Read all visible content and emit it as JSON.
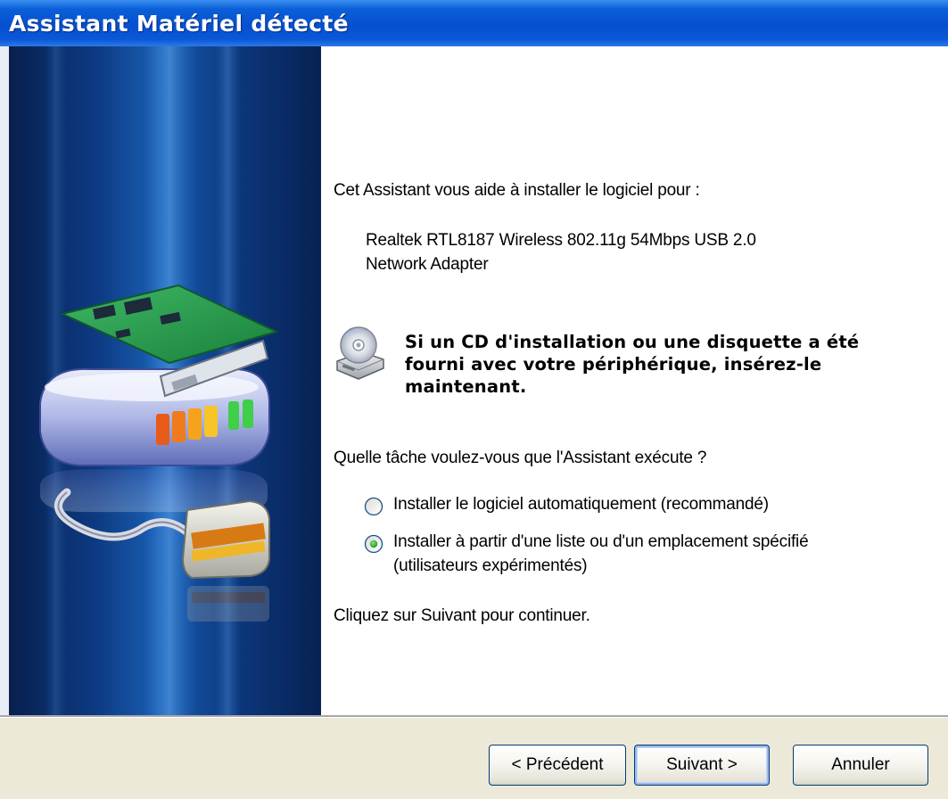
{
  "window": {
    "title": "Assistant Matériel détecté"
  },
  "content": {
    "intro": "Cet Assistant vous aide à installer le logiciel pour :",
    "device_line1": "Realtek RTL8187 Wireless 802.11g 54Mbps USB 2.0",
    "device_line2": "Network Adapter",
    "notice_icon": "cd-drive-icon",
    "notice_lines": [
      "Si un CD d'installation ou une disquette a été",
      "fourni avec votre périphérique, insérez-le",
      "maintenant."
    ],
    "question": "Quelle tâche voulez-vous que l'Assistant exécute ?",
    "options": [
      {
        "line1": "Installer le logiciel automatiquement (recommandé)",
        "selected": false
      },
      {
        "line1": "Installer à partir d'une liste ou d'un emplacement spécifié",
        "line2": "(utilisateurs expérimentés)",
        "selected": true
      }
    ],
    "continue_hint": "Cliquez sur Suivant pour continuer."
  },
  "footer": {
    "back_label": "< Précédent",
    "next_label": "Suivant >",
    "cancel_label": "Annuler"
  },
  "colors": {
    "titlebar": "#0550cf",
    "banner": "#0d3a82",
    "footer_bg": "#ece9d8",
    "button_border": "#003c74",
    "radio_dot": "#21a121"
  }
}
